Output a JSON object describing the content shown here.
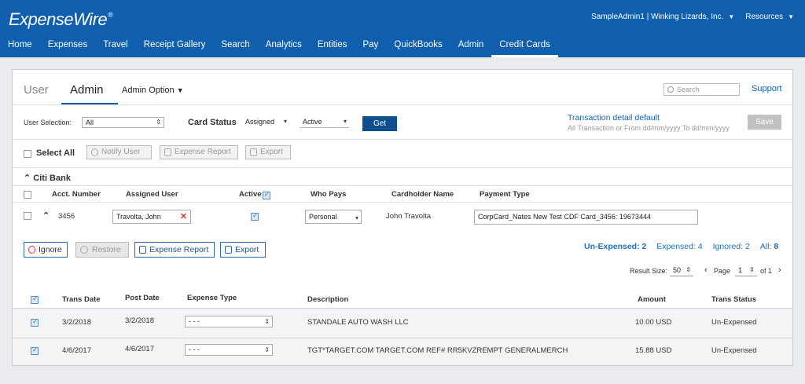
{
  "app": {
    "logo": "ExpenseWire",
    "logo_mark": "®",
    "account": "SampleAdmin1 | Winking Lizards, Inc.",
    "resources": "Resources"
  },
  "nav": [
    "Home",
    "Expenses",
    "Travel",
    "Receipt Gallery",
    "Search",
    "Analytics",
    "Entities",
    "Pay",
    "QuickBooks",
    "Admin",
    "Credit Cards"
  ],
  "nav_active": "Credit Cards",
  "tabs": {
    "user": "User",
    "admin": "Admin",
    "admin_option": "Admin Option"
  },
  "search": {
    "placeholder": "Search"
  },
  "support": "Support",
  "filters": {
    "user_selection_label": "User Selection:",
    "user_selection_value": "All",
    "card_status_label": "Card Status",
    "card_status_value": "Assigned",
    "active_value": "Active",
    "get_label": "Get",
    "tdd_title": "Transaction detail default",
    "tdd_sub": "All Transaction or From dd/mm/yyyy To dd/mm/yyyy",
    "save_label": "Save"
  },
  "actions": {
    "select_all": "Select All",
    "notify_user": "Notify User",
    "expense_report": "Expense Report",
    "export": "Export"
  },
  "bank": {
    "name": "Citi Bank",
    "headers": {
      "acct": "Acct. Number",
      "assigned": "Assigned User",
      "active": "Active",
      "who_pays": "Who Pays",
      "cardholder": "Cardholder Name",
      "payment_type": "Payment Type"
    },
    "row": {
      "acct": "3456",
      "assigned": "Travolta, John",
      "who_pays": "Personal",
      "cardholder": "John Travolta",
      "payment_type": "CorpCard_Nates New Test CDF Card_3456: 19673444"
    }
  },
  "txn_actions": {
    "ignore": "Ignore",
    "restore": "Restore",
    "expense_report": "Expense Report",
    "export": "Export"
  },
  "counts": {
    "unexpensed_label": "Un-Expensed:",
    "unexpensed": "2",
    "expensed_label": "Expensed:",
    "expensed": "4",
    "ignored_label": "Ignored:",
    "ignored": "2",
    "all_label": "All:",
    "all": "8"
  },
  "paging": {
    "result_size_label": "Result Size:",
    "result_size": "50",
    "page_label": "Page",
    "page": "1",
    "of_label": "of 1"
  },
  "transactions": {
    "headers": {
      "trans_date": "Trans Date",
      "post_date": "Post Date",
      "expense_type": "Expense Type",
      "description": "Description",
      "amount": "Amount",
      "status": "Trans Status"
    },
    "rows": [
      {
        "trans_date": "3/2/2018",
        "post_date": "3/2/2018",
        "expense_type": "- - -",
        "description": "STANDALE AUTO WASH LLC",
        "amount": "10.00 USD",
        "status": "Un-Expensed"
      },
      {
        "trans_date": "4/6/2017",
        "post_date": "4/6/2017",
        "expense_type": "- - -",
        "description": "TGT*TARGET.COM TARGET.COM REF# RR5KVZREMPT GENERALMERCH",
        "amount": "15.88 USD",
        "status": "Un-Expensed"
      }
    ]
  }
}
